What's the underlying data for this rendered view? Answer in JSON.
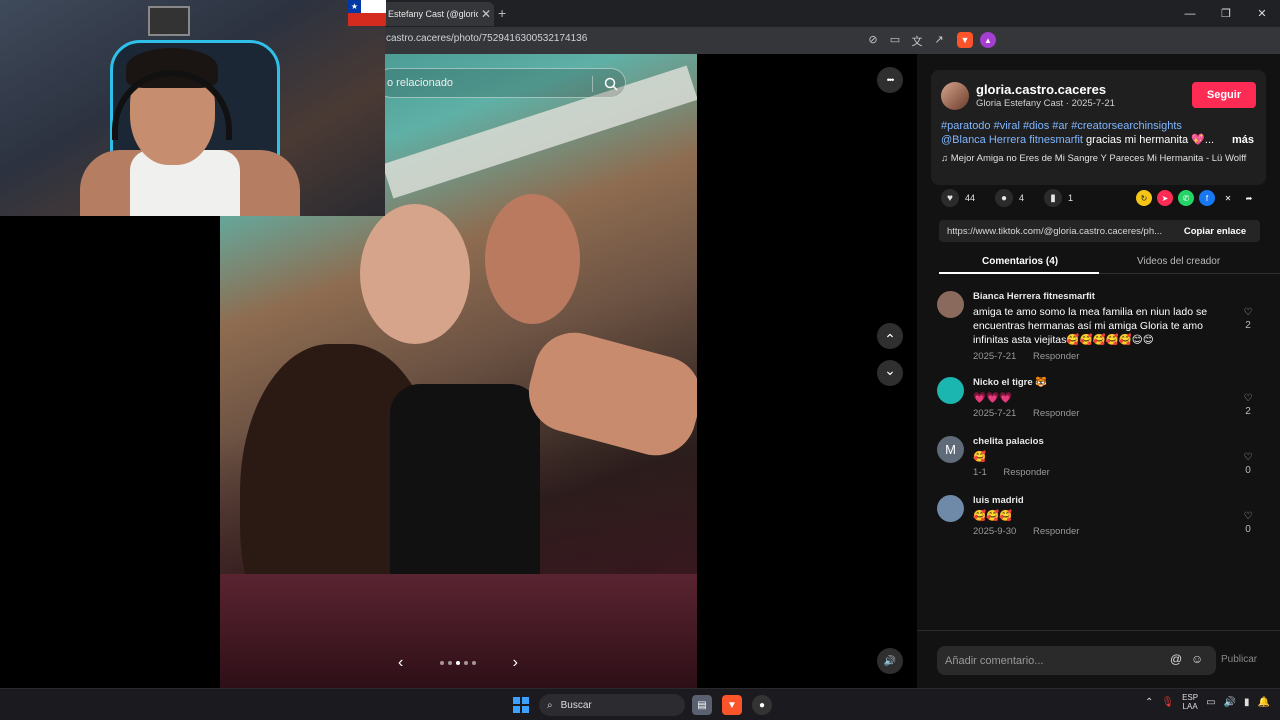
{
  "browser": {
    "tab_title": "Estefany Cast (@glorio",
    "tab_close": "✕",
    "new_tab": "+",
    "url": "castro.caceres/photo/7529416300532174136",
    "window_controls": [
      "—",
      "❐",
      "✕"
    ]
  },
  "viewer": {
    "search_placeholder": "o relacionado",
    "more_icon": "•••",
    "prev_post_icon": "⌃",
    "next_post_icon": "⌄",
    "carousel_prev": "‹",
    "carousel_next": "›",
    "carousel_dots": 5,
    "carousel_active": 3,
    "volume_icon": "🔊"
  },
  "author": {
    "username": "gloria.castro.caceres",
    "display_name": "Gloria Estefany Cast",
    "separator": " · ",
    "date": "2025-7-21",
    "follow_label": "Seguir"
  },
  "caption": {
    "hashtags": "#paratodo #viral #dios #ar #creatorsearchinsights",
    "mention": "@Blanca Herrera fitnesmarfit",
    "text": " gracias mi hermanita 💖...",
    "more": "más",
    "music": "♫  Mejor Amiga no Eres de Mi Sangre Y Pareces Mi Hermanita - Lü Wolff"
  },
  "actions": {
    "likes": "44",
    "comments": "4",
    "saves": "1"
  },
  "share": {
    "link": "https://www.tiktok.com/@gloria.castro.caceres/ph...",
    "copy_label": "Copiar enlace"
  },
  "tabs": {
    "comments": "Comentarios (4)",
    "creator_videos": "Videos del creador"
  },
  "comments": [
    {
      "name": "Bianca Herrera fitnesmarfit",
      "text": "amiga te amo somo la mea familia en niun lado se encuentras hermanas así mi amiga Gloria te amo infinitas asta viejitas🥰🥰🥰🥰🥰😊😊",
      "date": "2025-7-21",
      "reply": "Responder",
      "likes": "2",
      "avatar_color": "#8a6a5c"
    },
    {
      "name": "Nicko el tigre 🐯",
      "text": "💗💗💗",
      "date": "2025-7-21",
      "reply": "Responder",
      "likes": "2",
      "avatar_color": "#1bb6b0"
    },
    {
      "name": "chelita palacios",
      "avatar_letter": "M",
      "text": "🥰",
      "date": "1-1",
      "reply": "Responder",
      "likes": "0",
      "avatar_color": "#5f6b78"
    },
    {
      "name": "luis madrid",
      "text": "🥰🥰🥰",
      "date": "2025-9-30",
      "reply": "Responder",
      "likes": "0",
      "avatar_color": "#6e8aa8"
    }
  ],
  "comment_box": {
    "placeholder": "Añadir comentario...",
    "mention_icon": "@",
    "emoji_icon": "☺",
    "publish_label": "Publicar"
  },
  "taskbar": {
    "search_label": "Buscar",
    "language": "ESP",
    "region": "LAA"
  },
  "colors": {
    "accent": "#fe2c55",
    "link_blue": "#7fb6ff",
    "panel_bg": "#121212"
  }
}
